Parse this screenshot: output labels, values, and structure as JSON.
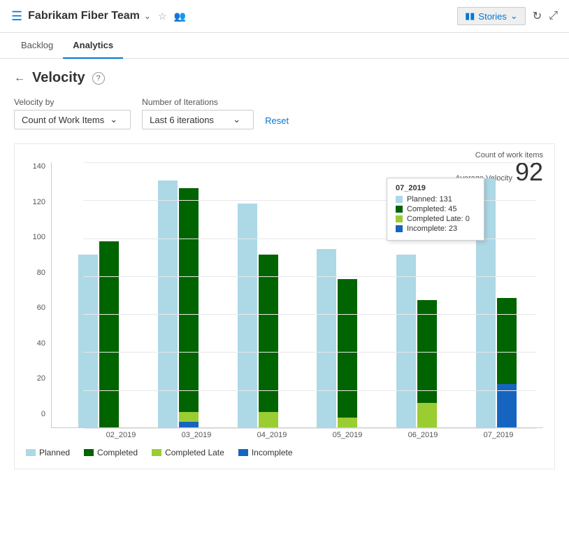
{
  "header": {
    "icon": "☰",
    "team_name": "Fabrikam Fiber Team",
    "chevron": "∨",
    "stories_label": "Stories",
    "refresh_label": "↻",
    "expand_label": "⤢"
  },
  "nav": {
    "tabs": [
      {
        "label": "Backlog",
        "active": false
      },
      {
        "label": "Analytics",
        "active": true
      }
    ]
  },
  "page": {
    "back": "←",
    "title": "Velocity",
    "help": "?"
  },
  "filters": {
    "velocity_by_label": "Velocity by",
    "velocity_by_value": "Count of Work Items",
    "iterations_label": "Number of Iterations",
    "iterations_value": "Last 6 iterations",
    "reset_label": "Reset"
  },
  "chart": {
    "meta_label1": "Count of work items",
    "meta_label2": "Average Velocity",
    "meta_value": "92",
    "y_labels": [
      "0",
      "20",
      "40",
      "60",
      "80",
      "100",
      "120",
      "140"
    ],
    "x_labels": [
      "02_2019",
      "03_2019",
      "04_2019",
      "05_2019",
      "06_2019",
      "07_2019"
    ],
    "tooltip": {
      "title": "07_2019",
      "rows": [
        {
          "color": "#add8e6",
          "label": "Planned: 131"
        },
        {
          "color": "#006400",
          "label": "Completed: 45"
        },
        {
          "color": "#9acd32",
          "label": "Completed Late: 0"
        },
        {
          "color": "#1565c0",
          "label": "Incomplete: 23"
        }
      ]
    },
    "bars": [
      {
        "label": "02_2019",
        "planned": 91,
        "completed": 98,
        "completed_late": 0,
        "incomplete": 0
      },
      {
        "label": "03_2019",
        "planned": 130,
        "completed": 118,
        "completed_late": 5,
        "incomplete": 3
      },
      {
        "label": "04_2019",
        "planned": 118,
        "completed": 83,
        "completed_late": 8,
        "incomplete": 0
      },
      {
        "label": "05_2019",
        "planned": 94,
        "completed": 73,
        "completed_late": 5,
        "incomplete": 0
      },
      {
        "label": "06_2019",
        "planned": 91,
        "completed": 54,
        "completed_late": 13,
        "incomplete": 0
      },
      {
        "label": "07_2019",
        "planned": 131,
        "completed": 45,
        "completed_late": 0,
        "incomplete": 23
      }
    ],
    "legend": [
      {
        "color": "#add8e6",
        "label": "Planned"
      },
      {
        "color": "#006400",
        "label": "Completed"
      },
      {
        "color": "#9acd32",
        "label": "Completed Late"
      },
      {
        "color": "#1565c0",
        "label": "Incomplete"
      }
    ],
    "max_value": 140
  }
}
